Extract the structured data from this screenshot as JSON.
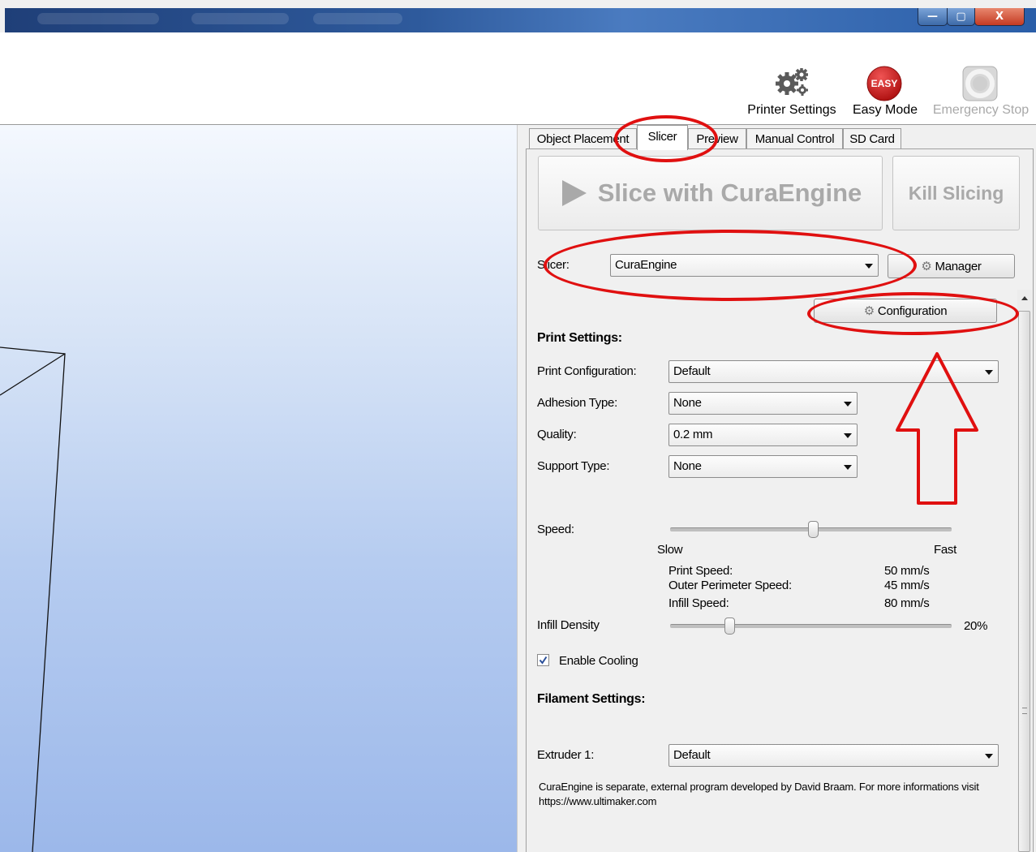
{
  "window": {
    "controls": {
      "minimize": "—",
      "maximize": "▢",
      "close": "X"
    }
  },
  "toolbar": {
    "printer_settings": "Printer Settings",
    "easy_mode": "Easy Mode",
    "easy_badge": "EASY",
    "emergency_stop": "Emergency Stop"
  },
  "tabs": [
    {
      "label": "Object Placement"
    },
    {
      "label": "Slicer"
    },
    {
      "label": "Preview"
    },
    {
      "label": "Manual Control"
    },
    {
      "label": "SD Card"
    }
  ],
  "slicer": {
    "slice_button": "Slice with CuraEngine",
    "kill_button": "Kill Slicing",
    "slicer_label": "Slicer:",
    "slicer_value": "CuraEngine",
    "manager_button": "Manager",
    "configuration_button": "Configuration",
    "print_settings_heading": "Print Settings:",
    "print_configuration_label": "Print Configuration:",
    "print_configuration_value": "Default",
    "adhesion_label": "Adhesion Type:",
    "adhesion_value": "None",
    "quality_label": "Quality:",
    "quality_value": "0.2 mm",
    "support_label": "Support Type:",
    "support_value": "None",
    "speed_label": "Speed:",
    "speed_slider_level": 0.51,
    "speed_min_label": "Slow",
    "speed_max_label": "Fast",
    "print_speed_label": "Print Speed:",
    "print_speed_value": "50 mm/s",
    "outer_perimeter_label": "Outer Perimeter Speed:",
    "outer_perimeter_value": "45 mm/s",
    "infill_speed_label": "Infill Speed:",
    "infill_speed_value": "80 mm/s",
    "infill_density_label": "Infill Density",
    "infill_density_level": 0.2,
    "infill_density_value": "20%",
    "enable_cooling_label": "Enable Cooling",
    "enable_cooling_checked": true,
    "filament_heading": "Filament Settings:",
    "extruder_label": "Extruder 1:",
    "extruder_value": "Default",
    "footer_note": "CuraEngine is separate, external program developed by David Braam. For more informations visit https://www.ultimaker.com"
  },
  "colors": {
    "annotation_red": "#e01010",
    "easy_red": "#d42020"
  }
}
